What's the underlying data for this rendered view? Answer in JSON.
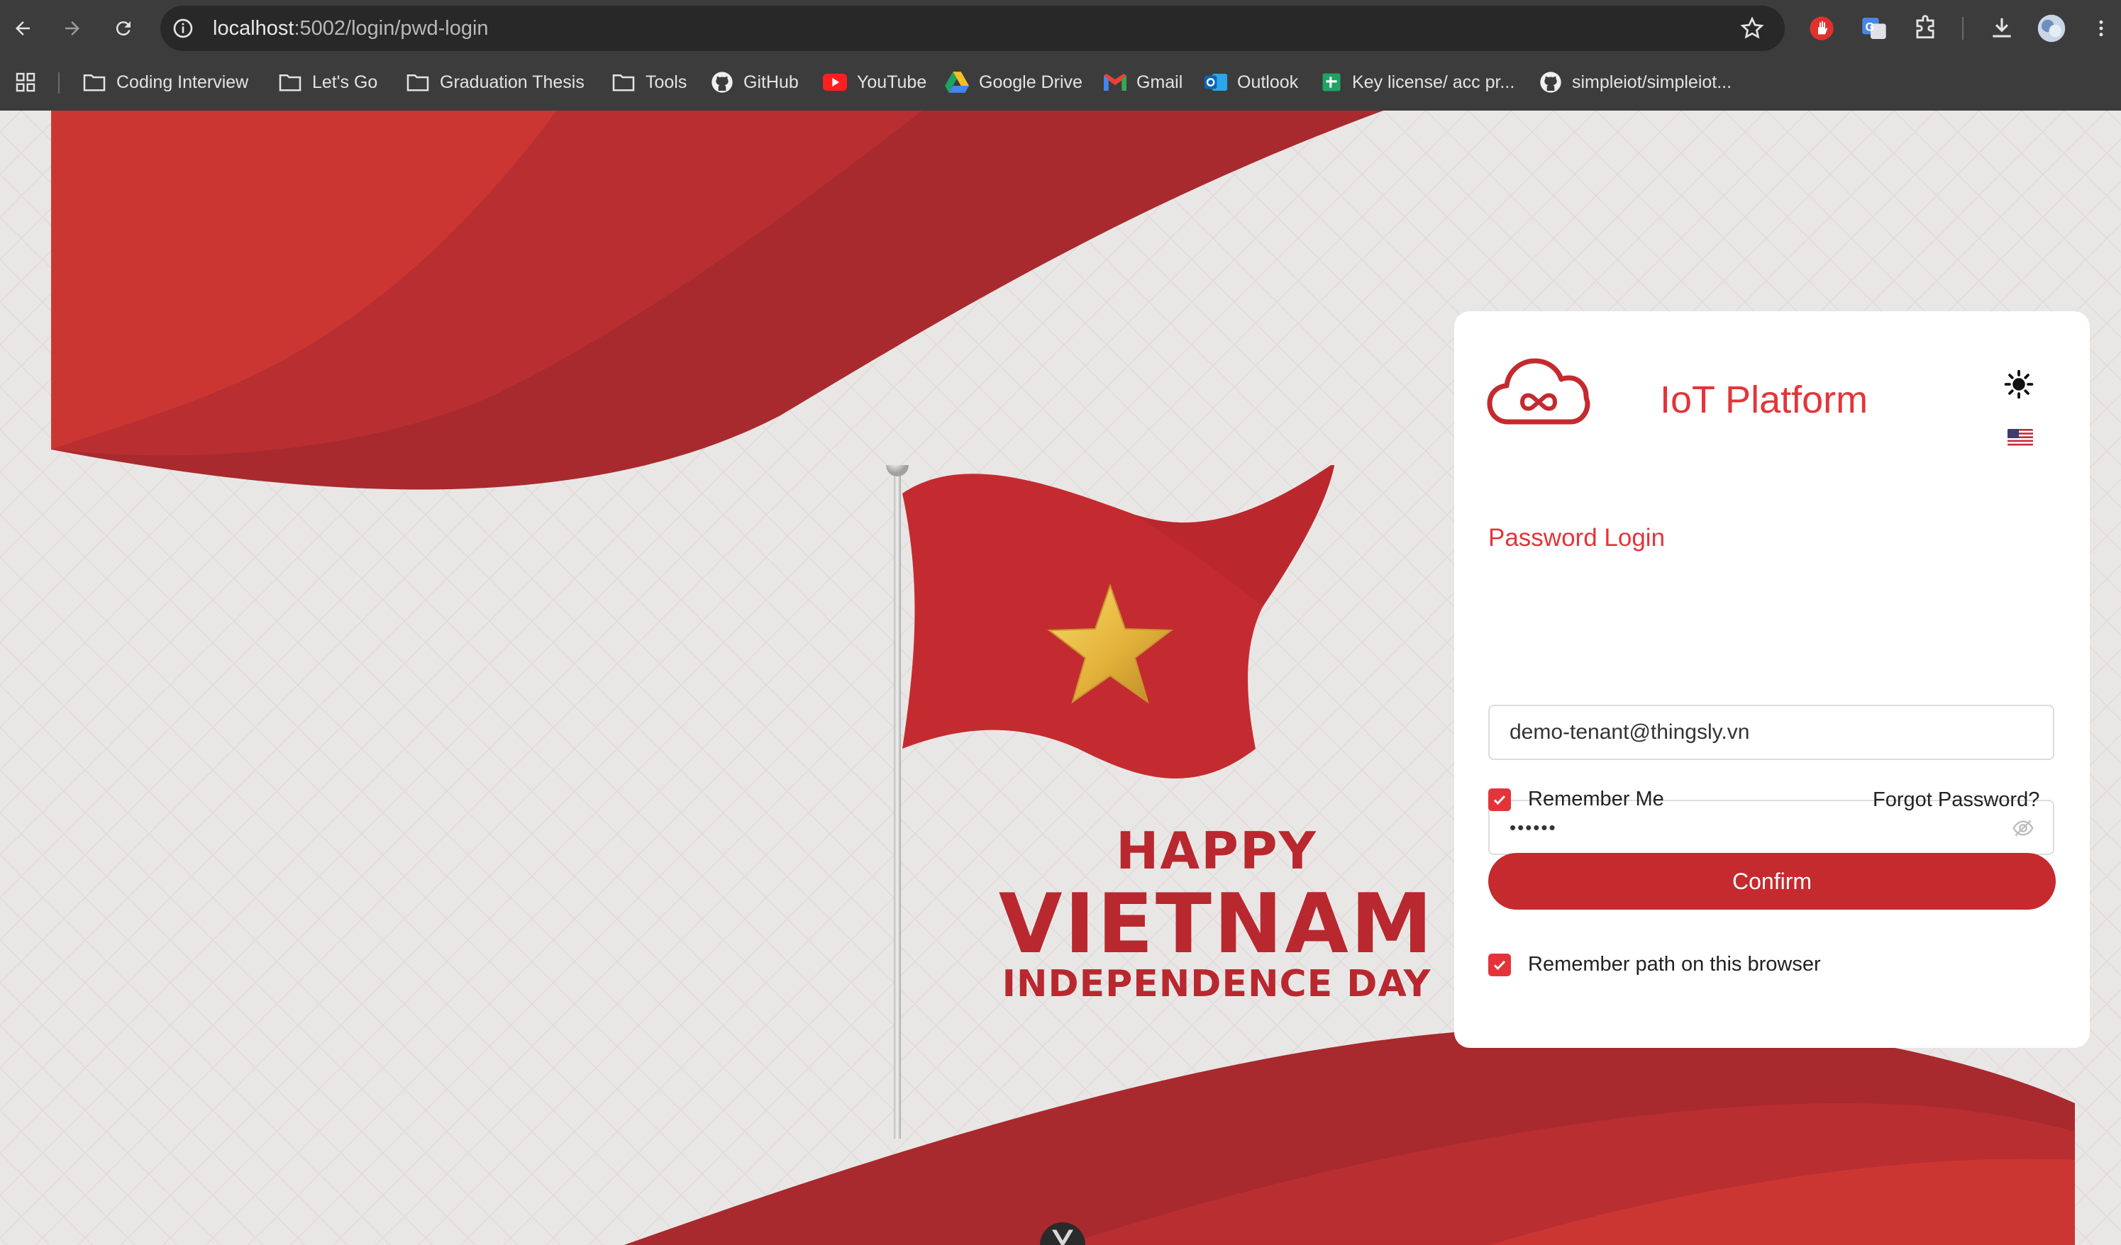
{
  "browser": {
    "url_host": "localhost",
    "url_path": ":5002/login/pwd-login",
    "bookmarks": [
      {
        "label": "Coding Interview",
        "icon": "folder-icon"
      },
      {
        "label": "Let's Go",
        "icon": "folder-icon"
      },
      {
        "label": "Graduation Thesis",
        "icon": "folder-icon"
      },
      {
        "label": "Tools",
        "icon": "folder-icon"
      },
      {
        "label": "GitHub",
        "icon": "github-icon"
      },
      {
        "label": "YouTube",
        "icon": "youtube-icon"
      },
      {
        "label": "Google Drive",
        "icon": "google-drive-icon"
      },
      {
        "label": "Gmail",
        "icon": "gmail-icon"
      },
      {
        "label": "Outlook",
        "icon": "outlook-icon"
      },
      {
        "label": "Key license/ acc pr...",
        "icon": "sheets-icon"
      },
      {
        "label": "simpleiot/simpleiot...",
        "icon": "github-icon"
      }
    ]
  },
  "banner": {
    "line1": "HAPPY",
    "line2": "VIETNAM",
    "line3": "INDEPENDENCE DAY"
  },
  "login": {
    "brand": "IoT Platform",
    "title": "Password Login",
    "username_value": "demo-tenant@thingsly.vn",
    "password_value": "••••••",
    "remember_me": "Remember Me",
    "forgot_password": "Forgot Password?",
    "confirm": "Confirm",
    "remember_path": "Remember path on this browser",
    "remember_me_checked": true,
    "remember_path_checked": true
  },
  "colors": {
    "accent": "#e4343a",
    "button": "#c42a2e",
    "banner_red": "#b8282e",
    "background": "#e9e7e5"
  }
}
